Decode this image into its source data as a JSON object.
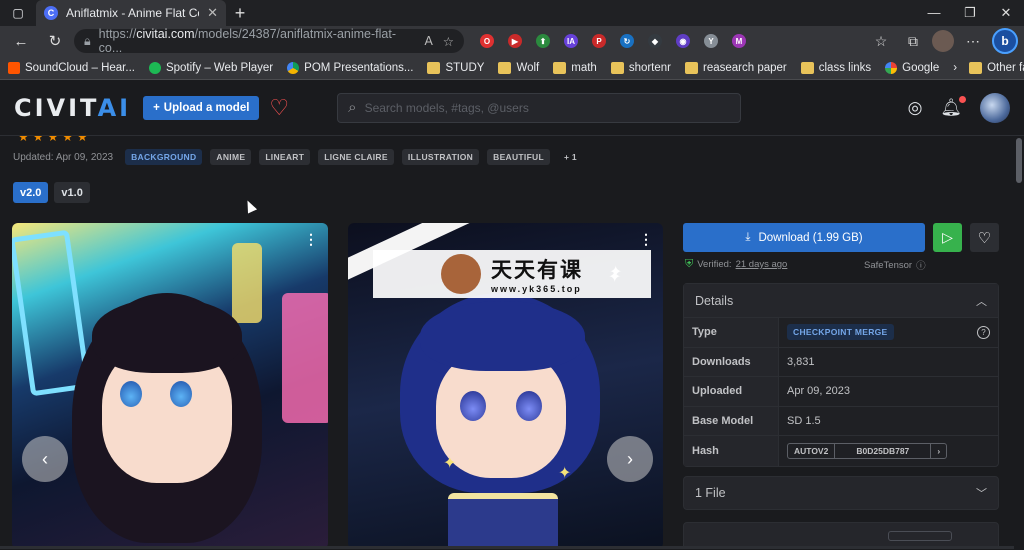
{
  "browser": {
    "tab_title": "Aniflatmix - Anime Flat Color Sty",
    "tab_favicon": "C",
    "url_prefix": "https://",
    "url_host": "civitai.com",
    "url_path": "/models/24387/aniflatmix-anime-flat-co...",
    "extensions": [
      {
        "name": "ext-red",
        "color": "#e03131",
        "glyph": "O"
      },
      {
        "name": "ext-youtube",
        "color": "#c92a2a",
        "glyph": "▶"
      },
      {
        "name": "ext-green",
        "color": "#2b8a3e",
        "glyph": "⬆"
      },
      {
        "name": "ext-ia",
        "color": "#6741d9",
        "glyph": "IA"
      },
      {
        "name": "ext-pin",
        "color": "#c92a2a",
        "glyph": "P"
      },
      {
        "name": "ext-blue-refresh",
        "color": "#1971c2",
        "glyph": "↻"
      },
      {
        "name": "ext-shield",
        "color": "#343a40",
        "glyph": "◆"
      },
      {
        "name": "ext-globe",
        "color": "#5f3dc4",
        "glyph": "◉"
      },
      {
        "name": "ext-y",
        "color": "#868e96",
        "glyph": "Y"
      },
      {
        "name": "ext-purple",
        "color": "#9c36b5",
        "glyph": "M"
      }
    ]
  },
  "bookmarks": [
    {
      "label": "SoundCloud – Hear...",
      "type": "soundcloud"
    },
    {
      "label": "Spotify – Web Player",
      "type": "spotify"
    },
    {
      "label": "POM Presentations...",
      "type": "drive"
    },
    {
      "label": "STUDY",
      "type": "folder"
    },
    {
      "label": "Wolf",
      "type": "folder"
    },
    {
      "label": "math",
      "type": "folder"
    },
    {
      "label": "shortenr",
      "type": "folder"
    },
    {
      "label": "reasearch paper",
      "type": "folder"
    },
    {
      "label": "class links",
      "type": "folder"
    },
    {
      "label": "Google",
      "type": "google"
    }
  ],
  "bookmarks_other": "Other favorites",
  "site": {
    "logo_main": "CIVIT",
    "logo_accent": "AI",
    "upload_label": "Upload a model",
    "search_placeholder": "Search models, #tags, @users"
  },
  "model": {
    "updated": "Updated: Apr 09, 2023",
    "tags": [
      "BACKGROUND",
      "ANIME",
      "LINEART",
      "LIGNE CLAIRE",
      "ILLUSTRATION",
      "BEAUTIFUL"
    ],
    "more_tags": "+ 1",
    "versions": [
      "v2.0",
      "v1.0"
    ],
    "active_version": "v2.0"
  },
  "watermark": {
    "big": "天天有课",
    "small": "www.yk365.top"
  },
  "download": {
    "label": "Download (1.99 GB)",
    "verified_prefix": "Verified:",
    "verified_when": "21 days ago",
    "safetensor": "SafeTensor"
  },
  "details": {
    "title": "Details",
    "rows": [
      {
        "key": "Type",
        "value": "CHECKPOINT MERGE"
      },
      {
        "key": "Downloads",
        "value": "3,831"
      },
      {
        "key": "Uploaded",
        "value": "Apr 09, 2023"
      },
      {
        "key": "Base Model",
        "value": "SD 1.5"
      },
      {
        "key": "Hash",
        "value_type": "AUTOV2",
        "value": "B0D25DB787"
      }
    ]
  },
  "files": {
    "label": "1 File"
  }
}
